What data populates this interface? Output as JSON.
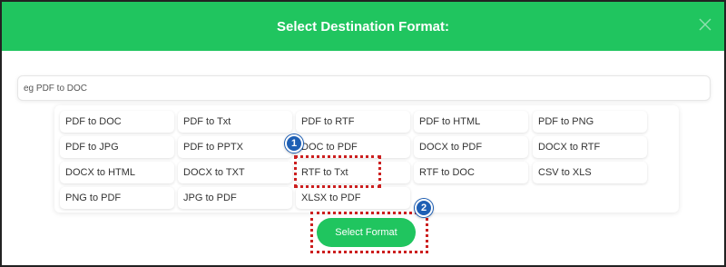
{
  "modal": {
    "title": "Select Destination Format:",
    "close_icon": "close-icon"
  },
  "search": {
    "placeholder": "eg PDF to DOC",
    "value": ""
  },
  "options": [
    "PDF to DOC",
    "PDF to Txt",
    "PDF to RTF",
    "PDF to HTML",
    "PDF to PNG",
    "PDF to JPG",
    "PDF to PPTX",
    "DOC to PDF",
    "DOCX to PDF",
    "DOCX to RTF",
    "DOCX to HTML",
    "DOCX to TXT",
    "RTF to Txt",
    "RTF to DOC",
    "CSV to XLS",
    "PNG to PDF",
    "JPG to PDF",
    "XLSX to PDF"
  ],
  "annotations": {
    "badge_1": "1",
    "badge_2": "2"
  },
  "select_button": {
    "label": "Select Format"
  },
  "colors": {
    "header": "#20c55f",
    "button": "#20c55f",
    "annotation_border": "#cc1f1f",
    "badge": "#1e5fb4"
  }
}
